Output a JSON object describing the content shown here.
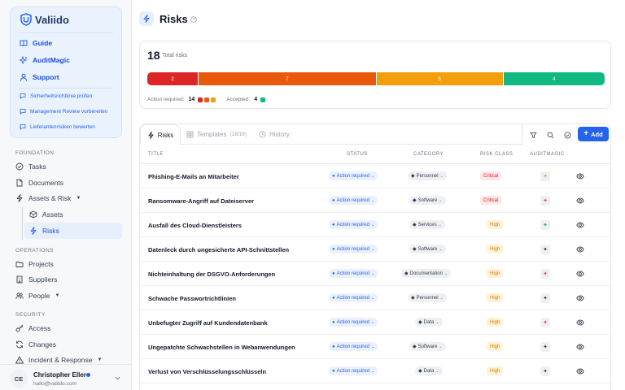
{
  "app": {
    "name": "Valiido"
  },
  "sidebar": {
    "primary": [
      {
        "label": "Guide",
        "icon": "book-icon"
      },
      {
        "label": "AuditMagic",
        "icon": "sparkle-icon"
      },
      {
        "label": "Support",
        "icon": "user-icon"
      }
    ],
    "actions": [
      {
        "label": "Sicherheitsrichtlinie prüfen"
      },
      {
        "label": "Management Review vorbereiten"
      },
      {
        "label": "Lieferantenrisiken bewerten"
      }
    ],
    "sections": {
      "foundation": "Foundation",
      "operations": "Operations",
      "security": "Security"
    },
    "foundation_items": {
      "tasks": "Tasks",
      "documents": "Documents",
      "assets_risk": "Assets & Risk",
      "assets": "Assets",
      "risks": "Risks"
    },
    "operations_items": {
      "projects": "Projects",
      "suppliers": "Suppliers",
      "people": "People"
    },
    "security_items": {
      "access": "Access",
      "changes": "Changes",
      "incident": "Incident & Response"
    },
    "user": {
      "initials": "CE",
      "name": "Christopher Eller",
      "email": "hallo@valiido.com"
    }
  },
  "header": {
    "title": "Risks"
  },
  "summary": {
    "total": "18",
    "total_label": "Total risks",
    "segments": [
      {
        "value": 2,
        "color": "#dc2626"
      },
      {
        "value": 7,
        "color": "#ea580c"
      },
      {
        "value": 5,
        "color": "#f59e0b"
      },
      {
        "value": 4,
        "color": "#10b981"
      }
    ],
    "action_label": "Action required:",
    "action_count": "14",
    "accepted_label": "Accepted:",
    "accepted_count": "4"
  },
  "tabs": [
    {
      "label": "Risks",
      "count": ""
    },
    {
      "label": "Templates",
      "count": "(18/18)"
    },
    {
      "label": "History",
      "count": ""
    }
  ],
  "add_label": "Add",
  "columns": {
    "title": "Title",
    "status": "Status",
    "category": "Category",
    "risk_class": "Risk class",
    "auditmagic": "AuditMagic"
  },
  "rows": [
    {
      "title": "Phishing-E-Mails an Mitarbeiter",
      "status": "Action required",
      "category": "Personnel",
      "risk": "Critical",
      "am_color": "#f59e0b"
    },
    {
      "title": "Ransomware-Angriff auf Dateiserver",
      "status": "Action required",
      "category": "Software",
      "risk": "Critical",
      "am_color": "#ef4444"
    },
    {
      "title": "Ausfall des Cloud-Dienstleisters",
      "status": "Action required",
      "category": "Services",
      "risk": "High",
      "am_color": "#10b981"
    },
    {
      "title": "Datenleck durch ungesicherte API-Schnittstellen",
      "status": "Action required",
      "category": "Software",
      "risk": "High",
      "am_color": "#374151"
    },
    {
      "title": "Nichteinhaltung der DSGVO-Anforderungen",
      "status": "Action required",
      "category": "Documentation",
      "risk": "High",
      "am_color": "#ef4444"
    },
    {
      "title": "Schwache Passwortrichtlinien",
      "status": "Action required",
      "category": "Personnel",
      "risk": "High",
      "am_color": "#374151"
    },
    {
      "title": "Unbefugter Zugriff auf Kundendatenbank",
      "status": "Action required",
      "category": "Data",
      "risk": "High",
      "am_color": "#ef4444"
    },
    {
      "title": "Ungepatchte Schwachstellen in Webanwendungen",
      "status": "Action required",
      "category": "Software",
      "risk": "High",
      "am_color": "#374151"
    },
    {
      "title": "Verlust von Verschlüsselungsschlüsseln",
      "status": "Action required",
      "category": "Data",
      "risk": "High",
      "am_color": "#374151"
    }
  ]
}
